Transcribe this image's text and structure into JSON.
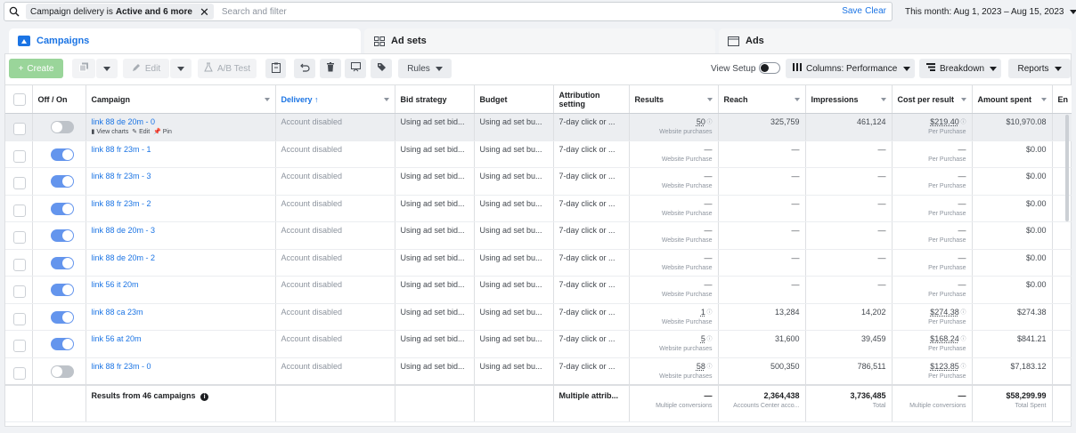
{
  "filter": {
    "chip_prefix": "Campaign delivery is",
    "chip_value": "Active and 6 more",
    "placeholder": "Search and filter",
    "save": "Save",
    "clear": "Clear"
  },
  "date_range": "This month: Aug 1, 2023 – Aug 15, 2023",
  "tabs": {
    "campaigns": "Campaigns",
    "ad_sets": "Ad sets",
    "ads": "Ads"
  },
  "toolbar": {
    "create": "Create",
    "edit": "Edit",
    "ab_test": "A/B Test",
    "rules": "Rules",
    "view_setup": "View Setup",
    "columns": "Columns: Performance",
    "breakdown": "Breakdown",
    "reports": "Reports"
  },
  "columns": {
    "off_on": "Off / On",
    "campaign": "Campaign",
    "delivery": "Delivery ↑",
    "bid_strategy": "Bid strategy",
    "budget": "Budget",
    "attribution": "Attribution setting",
    "results": "Results",
    "reach": "Reach",
    "impressions": "Impressions",
    "cost_per_result": "Cost per result",
    "amount_spent": "Amount spent",
    "extra": "En"
  },
  "row_actions": {
    "view_charts": "View charts",
    "edit": "Edit",
    "pin": "Pin"
  },
  "rows": [
    {
      "on": false,
      "name": "link 88 de 20m - 0",
      "delivery": "Account disabled",
      "bid": "Using ad set bid...",
      "budget": "Using ad set bu...",
      "attr": "7-day click or ...",
      "results": "50",
      "results_sub": "Website purchases",
      "reach": "325,759",
      "impr": "461,124",
      "cpr": "$219.40",
      "cpr_sub": "Per Purchase",
      "spent": "$10,970.08"
    },
    {
      "on": true,
      "name": "link 88 fr 23m - 1",
      "delivery": "Account disabled",
      "bid": "Using ad set bid...",
      "budget": "Using ad set bu...",
      "attr": "7-day click or ...",
      "results": "—",
      "results_sub": "Website Purchase",
      "reach": "—",
      "impr": "—",
      "cpr": "—",
      "cpr_sub": "Per Purchase",
      "spent": "$0.00"
    },
    {
      "on": true,
      "name": "link 88 fr 23m - 3",
      "delivery": "Account disabled",
      "bid": "Using ad set bid...",
      "budget": "Using ad set bu...",
      "attr": "7-day click or ...",
      "results": "—",
      "results_sub": "Website Purchase",
      "reach": "—",
      "impr": "—",
      "cpr": "—",
      "cpr_sub": "Per Purchase",
      "spent": "$0.00"
    },
    {
      "on": true,
      "name": "link 88 fr 23m - 2",
      "delivery": "Account disabled",
      "bid": "Using ad set bid...",
      "budget": "Using ad set bu...",
      "attr": "7-day click or ...",
      "results": "—",
      "results_sub": "Website Purchase",
      "reach": "—",
      "impr": "—",
      "cpr": "—",
      "cpr_sub": "Per Purchase",
      "spent": "$0.00"
    },
    {
      "on": true,
      "name": "link 88 de 20m - 3",
      "delivery": "Account disabled",
      "bid": "Using ad set bid...",
      "budget": "Using ad set bu...",
      "attr": "7-day click or ...",
      "results": "—",
      "results_sub": "Website Purchase",
      "reach": "—",
      "impr": "—",
      "cpr": "—",
      "cpr_sub": "Per Purchase",
      "spent": "$0.00"
    },
    {
      "on": true,
      "name": "link 88 de 20m - 2",
      "delivery": "Account disabled",
      "bid": "Using ad set bid...",
      "budget": "Using ad set bu...",
      "attr": "7-day click or ...",
      "results": "—",
      "results_sub": "Website Purchase",
      "reach": "—",
      "impr": "—",
      "cpr": "—",
      "cpr_sub": "Per Purchase",
      "spent": "$0.00"
    },
    {
      "on": true,
      "name": "link 56 it 20m",
      "delivery": "Account disabled",
      "bid": "Using ad set bid...",
      "budget": "Using ad set bu...",
      "attr": "7-day click or ...",
      "results": "—",
      "results_sub": "Website Purchase",
      "reach": "—",
      "impr": "—",
      "cpr": "—",
      "cpr_sub": "Per Purchase",
      "spent": "$0.00"
    },
    {
      "on": true,
      "name": "link 88 ca 23m",
      "delivery": "Account disabled",
      "bid": "Using ad set bid...",
      "budget": "Using ad set bu...",
      "attr": "7-day click or ...",
      "results": "1",
      "results_sub": "Website Purchase",
      "reach": "13,284",
      "impr": "14,202",
      "cpr": "$274.38",
      "cpr_sub": "Per Purchase",
      "spent": "$274.38"
    },
    {
      "on": true,
      "name": "link 56 at 20m",
      "delivery": "Account disabled",
      "bid": "Using ad set bid...",
      "budget": "Using ad set bu...",
      "attr": "7-day click or ...",
      "results": "5",
      "results_sub": "Website purchases",
      "reach": "31,600",
      "impr": "39,459",
      "cpr": "$168.24",
      "cpr_sub": "Per Purchase",
      "spent": "$841.21"
    },
    {
      "on": false,
      "name": "link 88 fr 23m - 0",
      "delivery": "Account disabled",
      "bid": "Using ad set bid...",
      "budget": "Using ad set bu...",
      "attr": "7-day click or ...",
      "results": "58",
      "results_sub": "Website purchases",
      "reach": "500,350",
      "impr": "786,511",
      "cpr": "$123.85",
      "cpr_sub": "Per Purchase",
      "spent": "$7,183.12"
    }
  ],
  "totals": {
    "label": "Results from 46 campaigns",
    "attr": "Multiple attrib...",
    "results": "—",
    "results_sub": "Multiple conversions",
    "reach": "2,364,438",
    "reach_sub": "Accounts Center acco...",
    "impr": "3,736,485",
    "impr_sub": "Total",
    "cpr": "—",
    "cpr_sub": "Multiple conversions",
    "spent": "$58,299.99",
    "spent_sub": "Total Spent"
  },
  "colors": {
    "accent": "#1b74e4",
    "toggle_on": "#6495ed",
    "create": "#9ad59a"
  }
}
